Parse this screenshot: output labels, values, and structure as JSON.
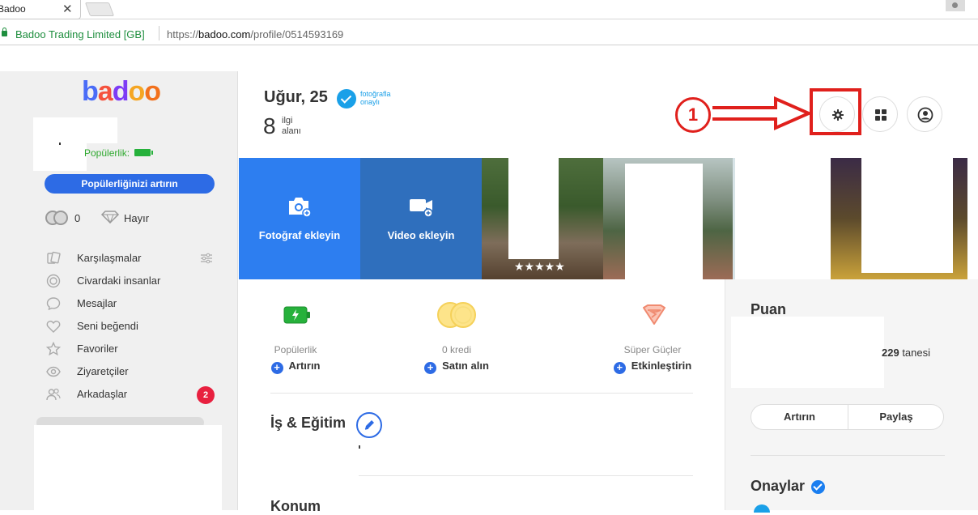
{
  "browser": {
    "tab_title": "Badoo",
    "site_name": "Badoo Trading Limited [GB]",
    "url_prefix": "https://",
    "url_host": "badoo.com",
    "url_path": "/profile/0514593169"
  },
  "sidebar": {
    "logo": [
      "b",
      "a",
      "d",
      "o",
      "o"
    ],
    "popularity_label": "Popülerlik:",
    "boost_button": "Popülerliğinizi artırın",
    "credits": "0",
    "superpowers": "Hayır",
    "nav": [
      {
        "label": "Karşılaşmalar",
        "icon": "encounters-icon"
      },
      {
        "label": "Civardaki insanlar",
        "icon": "nearby-icon"
      },
      {
        "label": "Mesajlar",
        "icon": "messages-icon"
      },
      {
        "label": "Seni beğendi",
        "icon": "heart-icon"
      },
      {
        "label": "Favoriler",
        "icon": "star-icon"
      },
      {
        "label": "Ziyaretçiler",
        "icon": "eye-icon"
      },
      {
        "label": "Arkadaşlar",
        "icon": "friends-icon",
        "badge": "2"
      }
    ]
  },
  "profile": {
    "name_age": "Uğur, 25",
    "verified_text": "fotoğrafla onaylı",
    "interest_count": "8",
    "interest_label": "ilgi alanı"
  },
  "annotation": {
    "number": "1"
  },
  "media": {
    "add_photo": "Fotoğraf ekleyin",
    "add_video": "Video ekleyin",
    "rating_stars": "★★★★★"
  },
  "stats": [
    {
      "label": "Popülerlik",
      "action": "Artırın"
    },
    {
      "label": "0 kredi",
      "action": "Satın alın"
    },
    {
      "label": "Süper Güçler",
      "action": "Etkinleştirin"
    }
  ],
  "sections": {
    "work_education": "İş & Eğitim",
    "location": "Konum"
  },
  "score": {
    "title": "Puan",
    "count_number": "229",
    "count_suffix": " tanesi",
    "boost": "Artırın",
    "share": "Paylaş"
  },
  "approvals": {
    "title": "Onaylar"
  },
  "colors": {
    "primary_blue": "#2d6be5",
    "annotation_red": "#e0201c",
    "badge_red": "#e8203f",
    "popularity_green": "#26b13b"
  }
}
